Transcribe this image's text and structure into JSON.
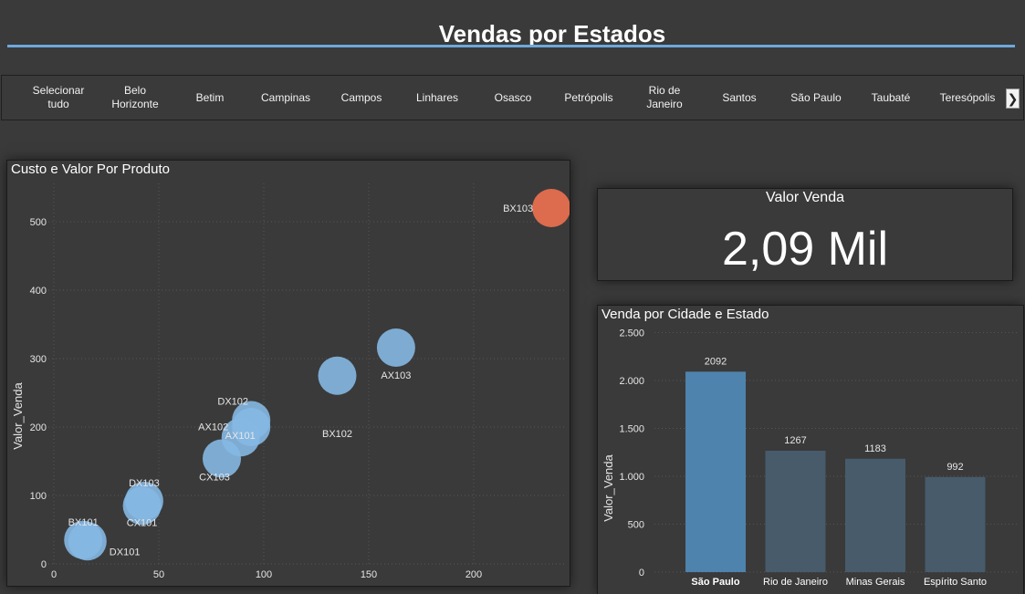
{
  "header": {
    "title": "Vendas por Estados"
  },
  "slicer": {
    "items": [
      "Selecionar tudo",
      "Belo Horizonte",
      "Betim",
      "Campinas",
      "Campos",
      "Linhares",
      "Osasco",
      "Petrópolis",
      "Rio de Janeiro",
      "Santos",
      "São Paulo",
      "Taubaté",
      "Teresópolis"
    ],
    "next_icon": "chevron-right-icon"
  },
  "scatter": {
    "title": "Custo e Valor Por Produto",
    "ylabel": "Valor_Venda"
  },
  "kpi": {
    "label": "Valor Venda",
    "value": "2,09 Mil"
  },
  "bar": {
    "title": "Venda por Cidade e Estado",
    "ylabel": "Valor_Venda"
  },
  "colors": {
    "bubble": "#85b8e3",
    "bubble_highlight": "#dd6b4d",
    "bar_selected": "#4e83ad",
    "bar": "#475b6b",
    "accent": "#6fa8dc"
  },
  "chart_data": [
    {
      "type": "scatter",
      "title": "Custo e Valor Por Produto",
      "xlabel": "",
      "ylabel": "Valor_Venda",
      "xlim": [
        0,
        230
      ],
      "ylim": [
        0,
        540
      ],
      "xticks": [
        "0",
        "50",
        "100",
        "150",
        "200"
      ],
      "yticks": [
        "0",
        "100",
        "200",
        "300",
        "400",
        "500"
      ],
      "grid": true,
      "points": [
        {
          "label": "BX103",
          "x": 237,
          "y": 520,
          "highlight": true
        },
        {
          "label": "AX103",
          "x": 163,
          "y": 316
        },
        {
          "label": "BX102",
          "x": 135,
          "y": 275
        },
        {
          "label": "DX102",
          "x": 94,
          "y": 210
        },
        {
          "label": "AX102",
          "x": 89,
          "y": 185
        },
        {
          "label": "AX101",
          "x": 94,
          "y": 200
        },
        {
          "label": "CX103",
          "x": 80,
          "y": 154
        },
        {
          "label": "DX103",
          "x": 43,
          "y": 92
        },
        {
          "label": "CX101",
          "x": 42,
          "y": 85
        },
        {
          "label": "BX101",
          "x": 14,
          "y": 35
        },
        {
          "label": "DX101",
          "x": 16,
          "y": 33
        }
      ]
    },
    {
      "type": "bar",
      "title": "Venda por Cidade e Estado",
      "xlabel": "",
      "ylabel": "Valor_Venda",
      "ylim": [
        0,
        2500
      ],
      "yticks": [
        "0",
        "500",
        "1.000",
        "1.500",
        "2.000",
        "2.500"
      ],
      "categories": [
        "São Paulo",
        "Rio de Janeiro",
        "Minas Gerais",
        "Espírito Santo"
      ],
      "values": [
        2092,
        1267,
        1183,
        992
      ],
      "selected": "São Paulo",
      "grid": true
    }
  ]
}
